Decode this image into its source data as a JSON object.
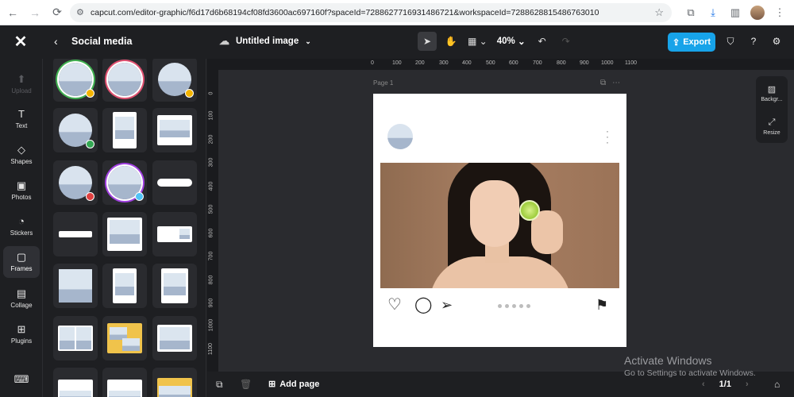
{
  "browser": {
    "url": "capcut.com/editor-graphic/f6d17d6b68194cf08fd3600ac697160f?spaceId=7288627716931486721&workspaceId=7288628815486763010"
  },
  "app": {
    "panel_title": "Social media",
    "doc_name": "Untitled image",
    "zoom": "40%",
    "export_label": "Export"
  },
  "rail": [
    {
      "label": "Upload",
      "icon": "upload-icon"
    },
    {
      "label": "Text",
      "icon": "text-icon"
    },
    {
      "label": "Shapes",
      "icon": "shapes-icon"
    },
    {
      "label": "Photos",
      "icon": "photos-icon"
    },
    {
      "label": "Stickers",
      "icon": "stickers-icon"
    },
    {
      "label": "Frames",
      "icon": "frames-icon"
    },
    {
      "label": "Collage",
      "icon": "collage-icon"
    },
    {
      "label": "Plugins",
      "icon": "plugins-icon"
    }
  ],
  "ruler": {
    "top": [
      "0",
      "100",
      "200",
      "300",
      "400",
      "500",
      "600",
      "700",
      "800",
      "900",
      "1000",
      "1100"
    ],
    "left": [
      "0",
      "100",
      "200",
      "300",
      "400",
      "500",
      "600",
      "700",
      "800",
      "900",
      "1000",
      "1100"
    ]
  },
  "canvas": {
    "page_label": "Page 1"
  },
  "side_tools": {
    "background": "Backgr...",
    "resize": "Resize"
  },
  "bottom": {
    "add_page": "Add page",
    "pager": "1/1"
  },
  "watermark": {
    "line1": "Activate Windows",
    "line2": "Go to Settings to activate Windows."
  },
  "colors": {
    "accent": "#17a3e9",
    "background": "#1e1f22",
    "canvas": "#2a2b2f"
  }
}
